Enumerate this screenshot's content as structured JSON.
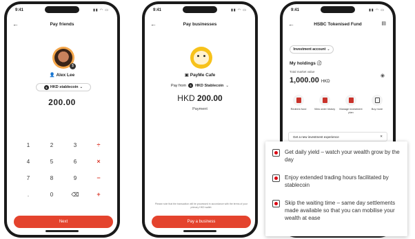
{
  "phone1": {
    "status_time": "9:41",
    "title": "Pay friends",
    "contact_name": "Alex Lee",
    "currency_selector": "HKD stablecoin",
    "amount": "200.00",
    "keys": [
      {
        "label": "1",
        "op": false
      },
      {
        "label": "2",
        "op": false
      },
      {
        "label": "3",
        "op": false
      },
      {
        "label": "÷",
        "op": true
      },
      {
        "label": "4",
        "op": false
      },
      {
        "label": "5",
        "op": false
      },
      {
        "label": "6",
        "op": false
      },
      {
        "label": "×",
        "op": true
      },
      {
        "label": "7",
        "op": false
      },
      {
        "label": "8",
        "op": false
      },
      {
        "label": "9",
        "op": false
      },
      {
        "label": "−",
        "op": true
      },
      {
        "label": ".",
        "op": false
      },
      {
        "label": "0",
        "op": false
      },
      {
        "label": "⌫",
        "op": false
      },
      {
        "label": "+",
        "op": true
      }
    ],
    "next_label": "Next"
  },
  "phone2": {
    "status_time": "9:41",
    "title": "Pay businesses",
    "merchant_name": "PayMe Cafe",
    "pay_from_label": "Pay from",
    "pay_from_value": "HKD Stablecoin",
    "amount_currency": "HKD",
    "amount_value": "200.00",
    "payment_label": "Payment",
    "disclaimer": "Please note that the transaction will be processed in accordance with the terms of your primary HKD wallet.",
    "pay_label": "Pay a business"
  },
  "phone3": {
    "status_time": "9:41",
    "title": "HSBC Tokenised Fund",
    "account_selector": "Investment account",
    "holdings_title": "My holdings",
    "mv_label": "Total market value",
    "mv_value": "1,000.00",
    "mv_currency": "HKD",
    "actions": [
      {
        "label": "Redeem fund"
      },
      {
        "label": "View order history"
      },
      {
        "label": "Manage investment plan"
      },
      {
        "label": "Buy more"
      }
    ],
    "banner_text": "Get a new investment experience"
  },
  "features": [
    {
      "text": "Get daily yield – watch your wealth grow by the day"
    },
    {
      "text": "Enjoy extended trading hours facilitated by stablecoin"
    },
    {
      "text": "Skip the waiting time – same day settlements made available so that you can mobilise your wealth at ease"
    }
  ],
  "colors": {
    "accent": "#e4432d",
    "brand": "#db0011"
  }
}
